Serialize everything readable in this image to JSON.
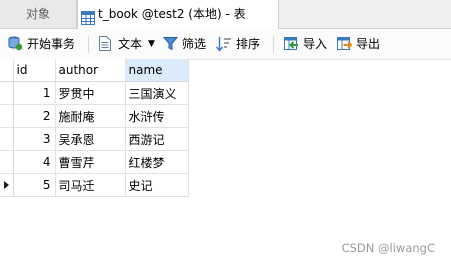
{
  "tabs": {
    "objects_label": "对象",
    "active_label": "t_book @test2 (本地) - 表"
  },
  "toolbar": {
    "begin_transaction": "开始事务",
    "text": "文本",
    "filter": "筛选",
    "sort": "排序",
    "import": "导入",
    "export": "导出"
  },
  "grid": {
    "columns": [
      "id",
      "author",
      "name"
    ],
    "rows": [
      {
        "id": "1",
        "author": "罗贯中",
        "name": "三国演义"
      },
      {
        "id": "2",
        "author": "施耐庵",
        "name": "水浒传"
      },
      {
        "id": "3",
        "author": "吴承恩",
        "name": "西游记"
      },
      {
        "id": "4",
        "author": "曹雪芹",
        "name": "红楼梦"
      },
      {
        "id": "5",
        "author": "司马迁",
        "name": "史记"
      }
    ],
    "current_row": 5
  },
  "watermark": "CSDN @liwangC"
}
